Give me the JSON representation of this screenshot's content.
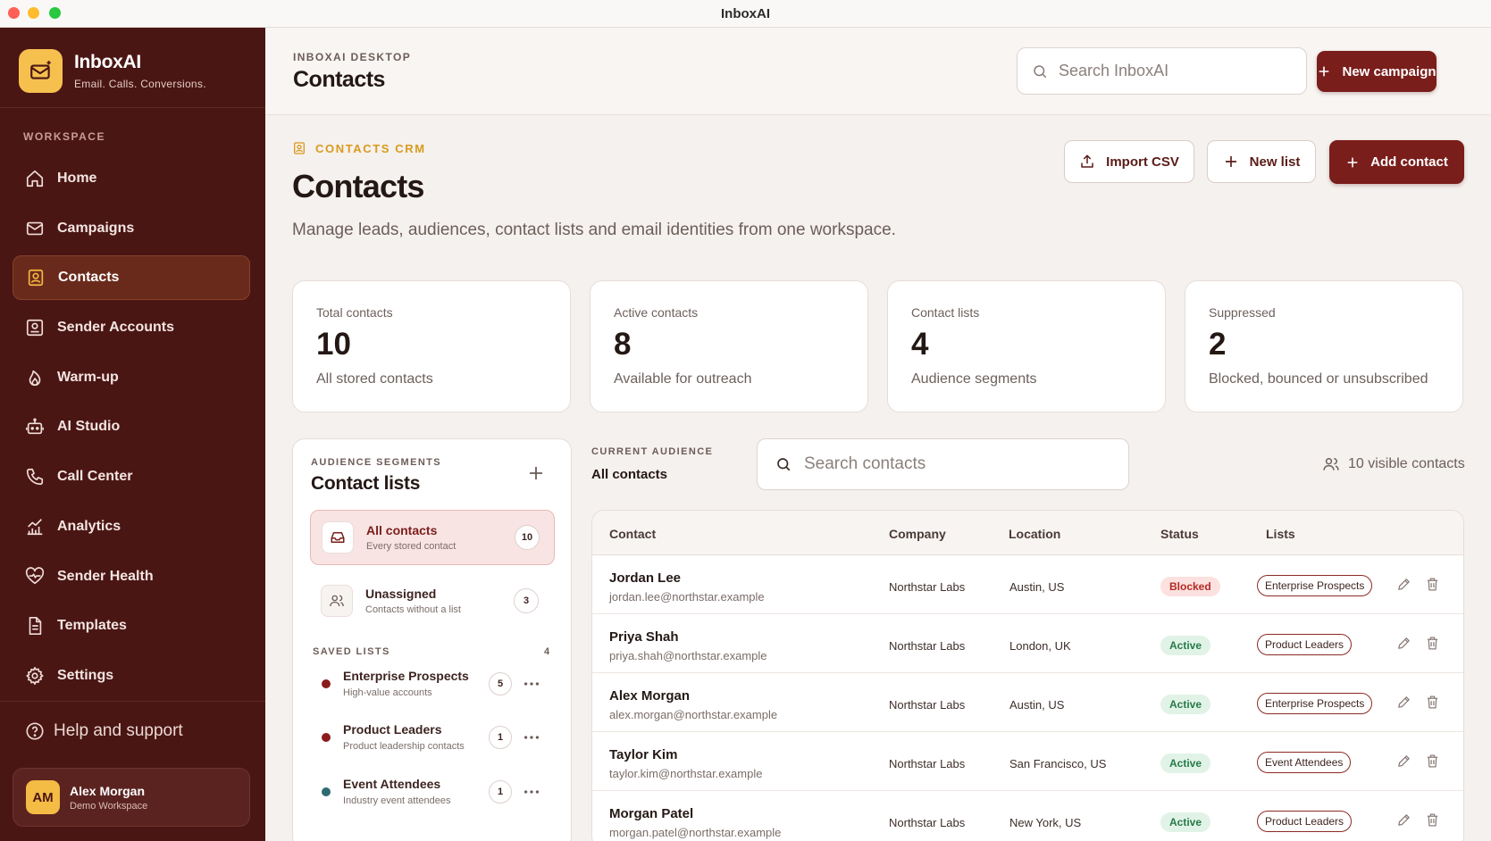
{
  "window": {
    "title": "InboxAI"
  },
  "brand": {
    "name": "InboxAI",
    "tagline": "Email. Calls. Conversions."
  },
  "sidebar": {
    "section_label": "WORKSPACE",
    "items": [
      {
        "label": "Home",
        "icon": "home-icon"
      },
      {
        "label": "Campaigns",
        "icon": "mail-icon"
      },
      {
        "label": "Contacts",
        "icon": "contact-card-icon",
        "active": true
      },
      {
        "label": "Sender Accounts",
        "icon": "sender-accounts-icon"
      },
      {
        "label": "Warm-up",
        "icon": "flame-icon"
      },
      {
        "label": "AI Studio",
        "icon": "robot-icon"
      },
      {
        "label": "Call Center",
        "icon": "phone-icon"
      },
      {
        "label": "Analytics",
        "icon": "chart-icon"
      },
      {
        "label": "Sender Health",
        "icon": "heart-pulse-icon"
      },
      {
        "label": "Templates",
        "icon": "document-icon"
      },
      {
        "label": "Settings",
        "icon": "gear-icon"
      }
    ],
    "help_label": "Help and support",
    "user": {
      "initials": "AM",
      "name": "Alex Morgan",
      "workspace": "Demo Workspace"
    }
  },
  "header": {
    "eyebrow": "INBOXAI DESKTOP",
    "title": "Contacts",
    "search_placeholder": "Search InboxAI",
    "new_campaign_label": "New campaign"
  },
  "main": {
    "eyebrow": "CONTACTS CRM",
    "title": "Contacts",
    "subtitle": "Manage leads, audiences, contact lists and email identities from one workspace.",
    "actions": {
      "import_csv": "Import CSV",
      "new_list": "New list",
      "add_contact": "Add contact"
    },
    "stats": [
      {
        "label": "Total contacts",
        "value": "10",
        "desc": "All stored contacts"
      },
      {
        "label": "Active contacts",
        "value": "8",
        "desc": "Available for outreach"
      },
      {
        "label": "Contact lists",
        "value": "4",
        "desc": "Audience segments"
      },
      {
        "label": "Suppressed",
        "value": "2",
        "desc": "Blocked, bounced or unsubscribed"
      }
    ]
  },
  "lists_panel": {
    "eyebrow": "AUDIENCE SEGMENTS",
    "title": "Contact lists",
    "segments": [
      {
        "name": "All contacts",
        "desc": "Every stored contact",
        "count": "10"
      },
      {
        "name": "Unassigned",
        "desc": "Contacts without a list",
        "count": "3"
      }
    ],
    "saved_label": "SAVED LISTS",
    "saved_count": "4",
    "saved": [
      {
        "name": "Enterprise Prospects",
        "desc": "High-value accounts",
        "count": "5",
        "color": "#8b1c1c"
      },
      {
        "name": "Product Leaders",
        "desc": "Product leadership contacts",
        "count": "1",
        "color": "#8b1c1c"
      },
      {
        "name": "Event Attendees",
        "desc": "Industry event attendees",
        "count": "1",
        "color": "#2f6b70"
      }
    ]
  },
  "audience": {
    "eyebrow": "CURRENT AUDIENCE",
    "title": "All contacts",
    "search_placeholder": "Search contacts",
    "visible_count": "10 visible contacts"
  },
  "table": {
    "headers": [
      "Contact",
      "Company",
      "Location",
      "Status",
      "Lists"
    ],
    "rows": [
      {
        "name": "Jordan Lee",
        "email": "jordan.lee@northstar.example",
        "company": "Northstar Labs",
        "location": "Austin, US",
        "status": "Blocked",
        "list": "Enterprise Prospects"
      },
      {
        "name": "Priya Shah",
        "email": "priya.shah@northstar.example",
        "company": "Northstar Labs",
        "location": "London, UK",
        "status": "Active",
        "list": "Product Leaders"
      },
      {
        "name": "Alex Morgan",
        "email": "alex.morgan@northstar.example",
        "company": "Northstar Labs",
        "location": "Austin, US",
        "status": "Active",
        "list": "Enterprise Prospects"
      },
      {
        "name": "Taylor Kim",
        "email": "taylor.kim@northstar.example",
        "company": "Northstar Labs",
        "location": "San Francisco, US",
        "status": "Active",
        "list": "Event Attendees"
      },
      {
        "name": "Morgan Patel",
        "email": "morgan.patel@northstar.example",
        "company": "Northstar Labs",
        "location": "New York, US",
        "status": "Active",
        "list": "Product Leaders"
      }
    ]
  },
  "colors": {
    "sidebar": "#4a1614",
    "accent": "#7a1e1b",
    "gold": "#f4bb45"
  }
}
